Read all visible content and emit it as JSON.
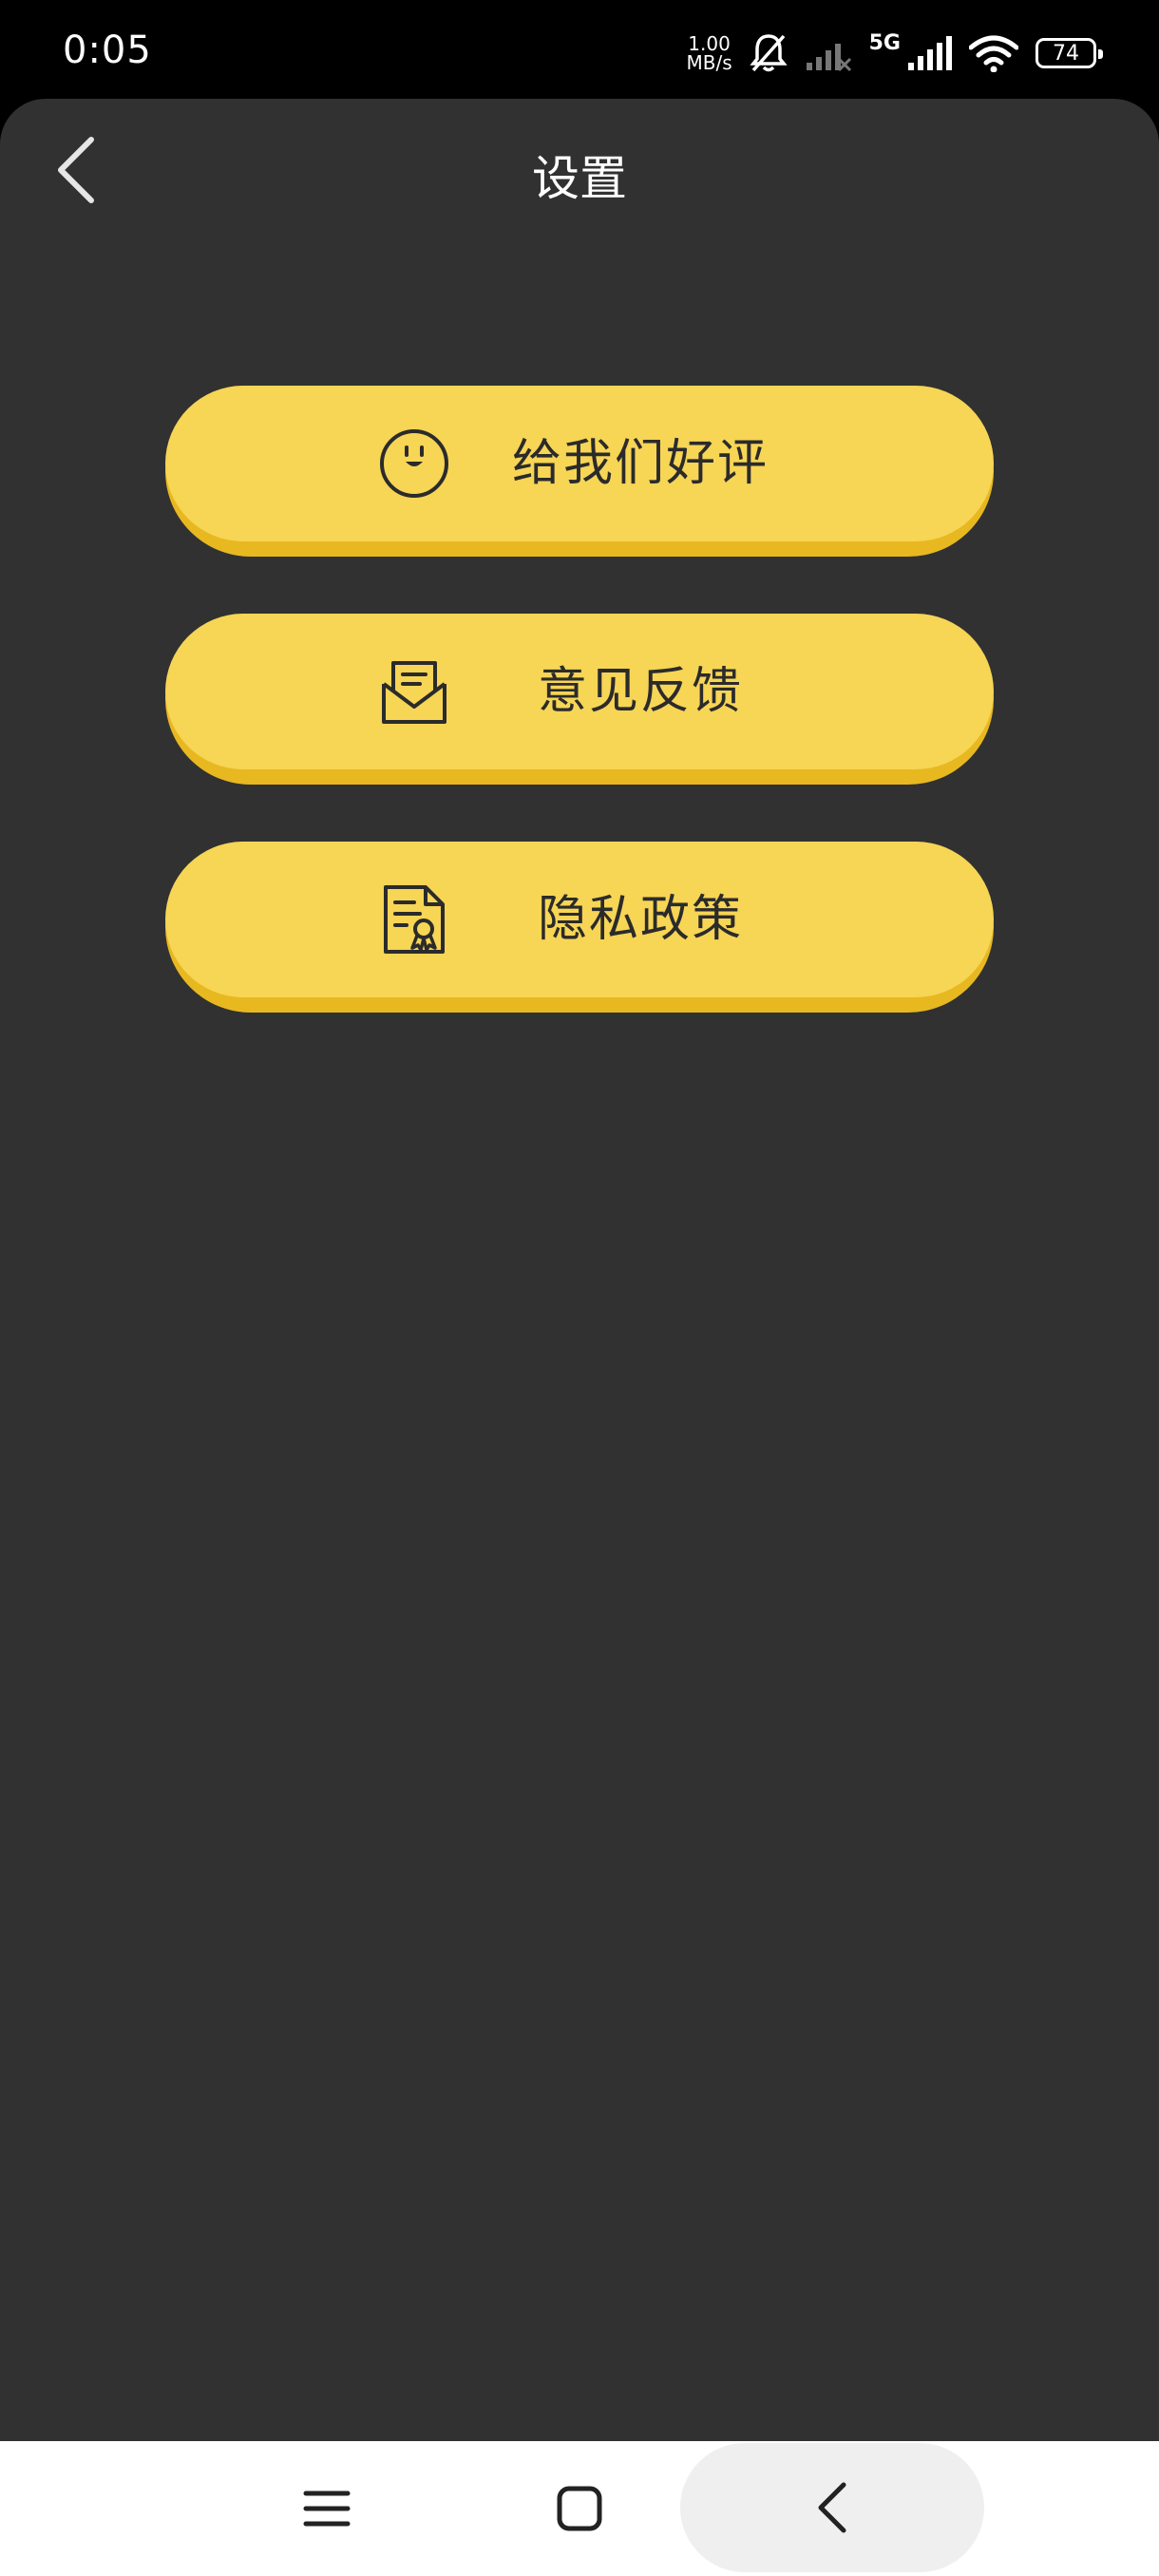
{
  "status_bar": {
    "time": "0:05",
    "speed_value": "1.00",
    "speed_unit": "MB/s",
    "network": "5G",
    "battery": "74"
  },
  "header": {
    "title": "设置"
  },
  "menu": [
    {
      "label": "给我们好评",
      "icon": "smiley-face-icon"
    },
    {
      "label": "意见反馈",
      "icon": "envelope-letter-icon"
    },
    {
      "label": "隐私政策",
      "icon": "certificate-document-icon"
    }
  ],
  "colors": {
    "background": "#313131",
    "button": "#f7d555",
    "button_shadow": "#e8b820",
    "text_dark": "#2b2b2b"
  }
}
